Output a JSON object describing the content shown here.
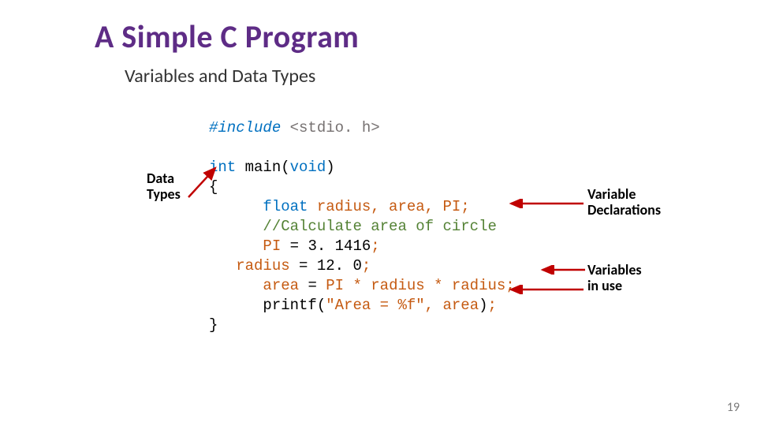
{
  "title": "A Simple C Program",
  "subtitle": "Variables and Data Types",
  "code": {
    "l1_inc": "#include",
    "l1_hdr": "<stdio. h>",
    "l2_type": "int ",
    "l2_fn": "main",
    "l2_p1": "(",
    "l2_void": "void",
    "l2_p2": ")",
    "l3_brace": "{",
    "l4_type": "float ",
    "l4_vars": "radius, area, PI;",
    "l5_comment": "//Calculate area of circle",
    "l6_lhs": "PI ",
    "l6_eq": "= ",
    "l6_rhs": "3. 1416",
    "l6_semi": ";",
    "l7_lhs": "radius ",
    "l7_eq": "= ",
    "l7_rhs": "12. 0",
    "l7_semi": ";",
    "l8_lhs": "area ",
    "l8_eq": "= ",
    "l8_rhs": "PI * radius * radius",
    "l8_semi": ";",
    "l9_fn": "printf",
    "l9_p1": "(",
    "l9_str": "\"Area = %f\"",
    "l9_comma": ", ",
    "l9_arg": "area",
    "l9_p2": ")",
    "l9_semi": ";",
    "l10_brace": "}"
  },
  "labels": {
    "data_types_l1": "Data",
    "data_types_l2": "Types",
    "var_decl_l1": "Variable",
    "var_decl_l2": "Declarations",
    "var_use_l1": "Variables",
    "var_use_l2": "in use"
  },
  "page": "19"
}
